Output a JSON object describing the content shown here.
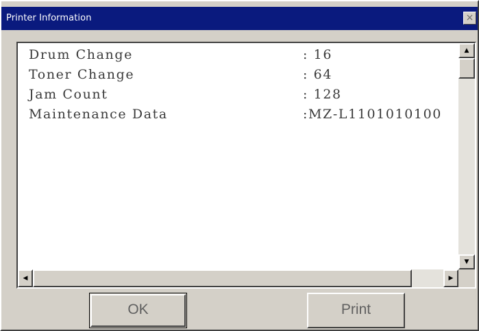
{
  "window": {
    "title": "Printer Information",
    "close_glyph": "×"
  },
  "info": {
    "rows": [
      {
        "label": "Drum Change",
        "value": ":   16"
      },
      {
        "label": "Toner Change",
        "value": ":   64"
      },
      {
        "label": "Jam Count",
        "value": ": 128"
      },
      {
        "label": "Maintenance Data",
        "value": ":MZ-L1101010100"
      }
    ]
  },
  "scrollbars": {
    "up_arrow": "▲",
    "down_arrow": "▼",
    "left_arrow": "◀",
    "right_arrow": "▶"
  },
  "buttons": {
    "ok_label": "OK",
    "print_label": "Print"
  },
  "colors": {
    "titlebar": "#0a1a7e",
    "face": "#d4d0c8",
    "list_background": "#ffffff"
  }
}
